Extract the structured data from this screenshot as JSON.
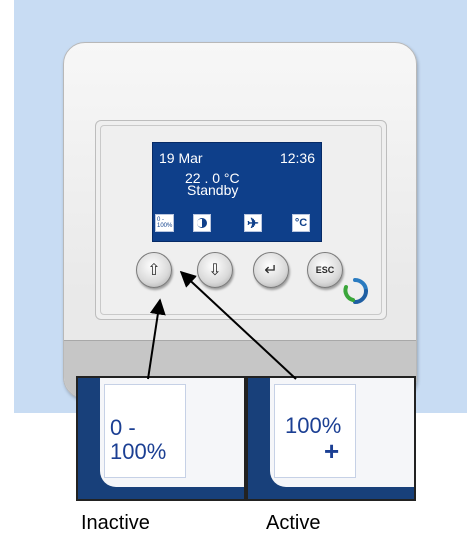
{
  "screen": {
    "date": "19 Mar",
    "time": "12:36",
    "temperature": "22 . 0 °C",
    "mode": "Standby",
    "range_icon_label": "0 - 100%",
    "fan_icon_glyph": "✈",
    "celsius_icon_label": "°C"
  },
  "buttons": {
    "up_glyph": "⇧",
    "down_glyph": "⇩",
    "enter_glyph": "↵",
    "esc_label": "ESC"
  },
  "zoom": {
    "inactive": {
      "line1": "0 -",
      "line2": "100%"
    },
    "active": {
      "line1": "100%",
      "line2": "+"
    }
  },
  "captions": {
    "inactive": "Inactive",
    "active": "Active"
  },
  "colors": {
    "background": "#c8dcf3",
    "screen": "#0e3f8a",
    "zoom_text": "#1b3f93"
  },
  "icons": [
    "range-icon",
    "moon-icon",
    "fan-icon",
    "celsius-icon",
    "up-arrow-icon",
    "down-arrow-icon",
    "enter-icon",
    "logo-icon"
  ]
}
